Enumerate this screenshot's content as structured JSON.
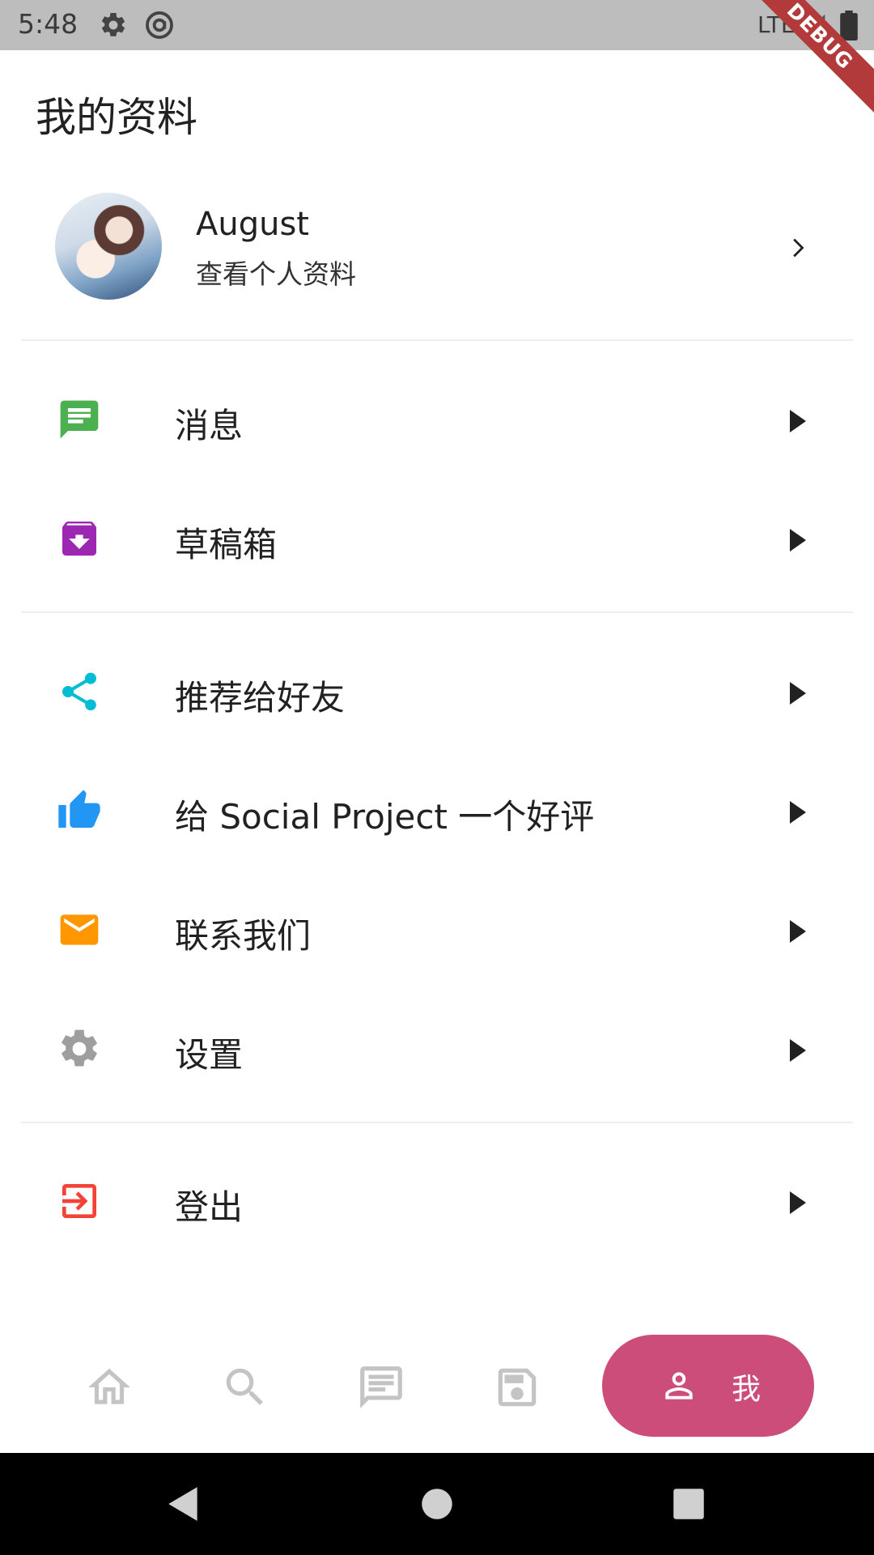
{
  "status_bar": {
    "time": "5:48",
    "network": "LTE",
    "icons": [
      "settings-icon",
      "at-sign-icon",
      "signal-icon",
      "battery-icon"
    ]
  },
  "debug_banner": "DEBUG",
  "header": {
    "title": "我的资料"
  },
  "profile": {
    "name": "August",
    "subtitle": "查看个人资料"
  },
  "menu": {
    "messages": {
      "label": "消息",
      "icon": "message-icon",
      "color": "#4caf50"
    },
    "drafts": {
      "label": "草稿箱",
      "icon": "archive-icon",
      "color": "#9c27b0"
    },
    "share": {
      "label": "推荐给好友",
      "icon": "share-icon",
      "color": "#00bcd4"
    },
    "rate": {
      "label": "给 Social Project 一个好评",
      "icon": "thumb-up-icon",
      "color": "#2196f3"
    },
    "contact": {
      "label": "联系我们",
      "icon": "mail-icon",
      "color": "#ff9800"
    },
    "settings": {
      "label": "设置",
      "icon": "gear-icon",
      "color": "#9e9e9e"
    },
    "logout": {
      "label": "登出",
      "icon": "exit-icon",
      "color": "#f44336"
    }
  },
  "bottom_nav": {
    "items": [
      "home-icon",
      "search-icon",
      "message-icon",
      "save-icon",
      "person-icon"
    ],
    "active_label": "我",
    "active_color": "#cc4d7a",
    "inactive_color": "#c4c4c4"
  }
}
